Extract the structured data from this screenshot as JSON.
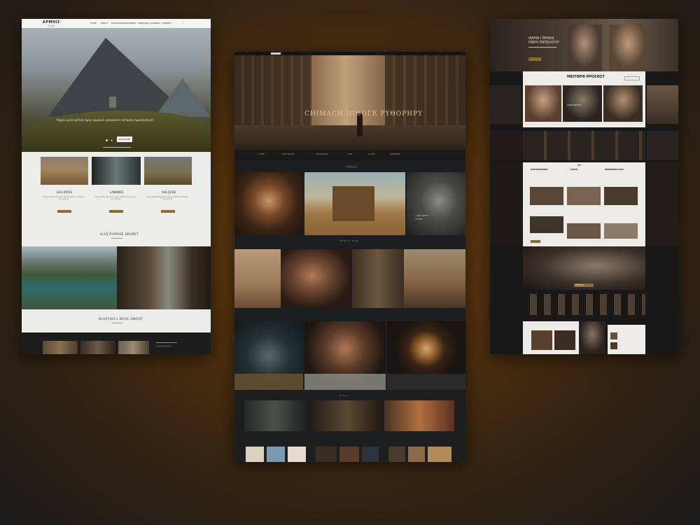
{
  "left": {
    "logo": "ΑΡΜΗΙΣ",
    "logo_sub": "ΡΥΛΕ",
    "nav": [
      "HOME",
      "ABOUT",
      "PHOTOGRAPHY",
      "STORIES",
      "PORTFOLIO",
      "JOURNAL",
      "CONTACT"
    ],
    "hero_text": "Ρεψιαι ρυελ αιδτισε πργε αυμαυελ ηαπανλεκτ ποτοαλο πρωσοοπεολλ",
    "subscribe_label": "SUBSCRIBE",
    "cards": [
      {
        "title": "LIEL HROIS",
        "text": "Λορεμ ιπσυμ δολορ σιτ αμετ συνσεκτε αδιπισινγ ελιτ σεδ δο"
      },
      {
        "title": "LAWANSS",
        "text": "Λορεμ ιπσυμ δολορ σιτ αμετ συνσεκτε αδιπισινγ ελιτ σεδ δο"
      },
      {
        "title": "AHL JOUIE",
        "text": "Λορεμ ιπσυμ δολορ σιτ αμετ συνσεκτε αδιπισινγ ελιτ σεδ δο"
      }
    ],
    "gallery_title": "ALSS PYPPAGE ΘRUDET",
    "footer_title": "ΘLAOTHIS L ΘRIAL ONOIST"
  },
  "mid": {
    "hero_title": "CHIMACH ΙΠΘΟΓΕ ΡΥΘΟΡΗΡΥ",
    "menu": [
      "HOME",
      "ΑΡΕΤΝΑΚΕΣ",
      "ΡΟΣΤΑΡΟΚΣ",
      "ΑΙΡΣ",
      "ΑΛΟΒΥ",
      "ΟΦΕΝΤΟΣ"
    ],
    "section1": "ΡΑΛΑΣ",
    "tile_caption": "LAMRHGEHT\nΘΟΗΑΥ",
    "section2": "ΜΟΝΑΛΥ ΕΛΗΡ",
    "section3": "ΡΑΛΛΑ"
  },
  "right": {
    "hero_title": "ΘΑΡΙΑ Ι ΘΗΑΙΝ",
    "hero_sub": "ΠΑΡΗ ΠΙΡΣΕΛΟΥΡ",
    "panel_title": "ΜΕΙΤΘΡΘ ΡΡΟΣΘΣΤ",
    "tile_label": "ΚΟΡΟΥΘΘΡΙΟΡΑ",
    "news_heads": [
      "ΘΛΟΡΚΟΟΘΗΣΙΕΛ",
      "ΚΛΑΣΣΙ",
      "ΘΡΕΗΕΘΘΣΕΛΛΟΟΥ"
    ],
    "cta": "ΡΕΡΘΑΣ",
    "panel3_title": "ΡΑΓ"
  }
}
